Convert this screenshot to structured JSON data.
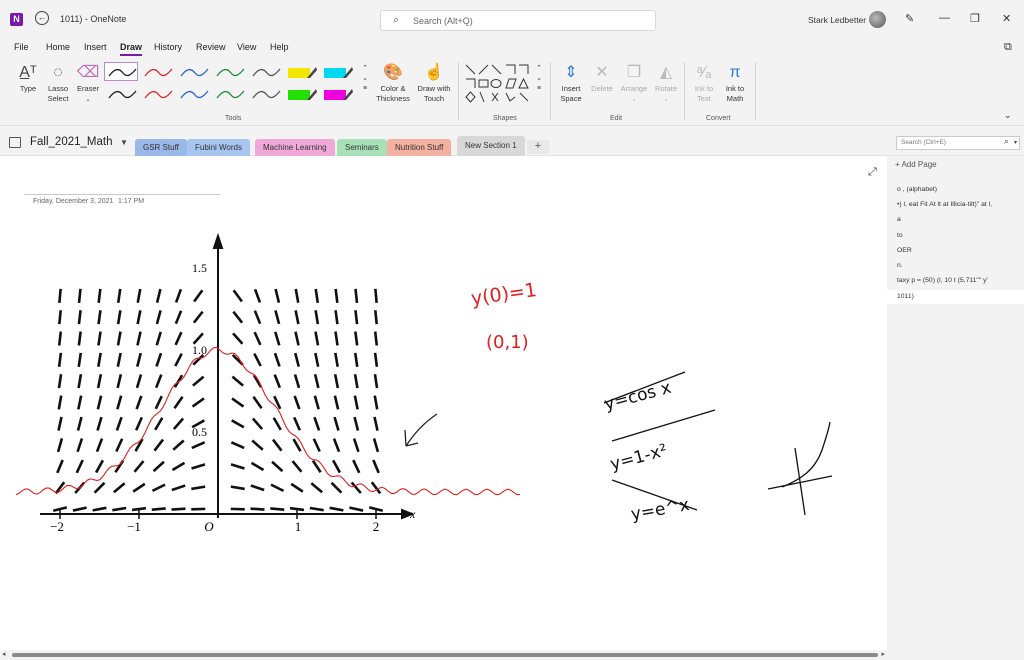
{
  "window": {
    "title": "1011) - OneNote",
    "search_placeholder": "Search (Alt+Q)",
    "user_name": "Stark Ledbetter"
  },
  "menu": {
    "items": [
      "File",
      "Home",
      "Insert",
      "Draw",
      "History",
      "Review",
      "View",
      "Help"
    ],
    "active": "Draw"
  },
  "ribbon": {
    "tools": {
      "type_label": "Type",
      "lasso_label": "Lasso\nSelect",
      "eraser_label": "Eraser",
      "group_label": "Tools"
    },
    "pens": [
      {
        "color": "#1a1a1a",
        "row": 0,
        "selected": true
      },
      {
        "color": "#d42a2a",
        "row": 0
      },
      {
        "color": "#2a5fd4",
        "row": 0
      },
      {
        "color": "#1e8a3a",
        "row": 0
      },
      {
        "color": "#555555",
        "row": 0
      },
      {
        "color": "#f5e600",
        "row": 0,
        "highlighter": true
      },
      {
        "color": "#00d8f0",
        "row": 0,
        "highlighter": true
      },
      {
        "color": "#1a1a1a",
        "row": 1
      },
      {
        "color": "#d42a2a",
        "row": 1
      },
      {
        "color": "#2a5fd4",
        "row": 1
      },
      {
        "color": "#1e8a3a",
        "row": 1
      },
      {
        "color": "#555555",
        "row": 1
      },
      {
        "color": "#22e000",
        "row": 1,
        "highlighter": true
      },
      {
        "color": "#f000e0",
        "row": 1,
        "highlighter": true
      }
    ],
    "color_thickness_label": "Color &\nThickness",
    "draw_touch_label": "Draw with\nTouch",
    "shapes_group_label": "Shapes",
    "edit": {
      "insert_space_label": "Insert\nSpace",
      "delete_label": "Delete",
      "arrange_label": "Arrange",
      "rotate_label": "Rotate",
      "group_label": "Edit"
    },
    "convert": {
      "ink_to_text_label": "Ink to\nText",
      "ink_to_math_label": "Ink to\nMath",
      "group_label": "Convert"
    }
  },
  "notebook": {
    "name": "Fall_2021_Math",
    "sections": [
      {
        "label": "GSR Stuff",
        "color": "#9ab8e8"
      },
      {
        "label": "Fubini Words",
        "color": "#a8c4f0"
      },
      {
        "label": "Machine Learning",
        "color": "#f0a8d8"
      },
      {
        "label": "Seminars",
        "color": "#a8e0b8"
      },
      {
        "label": "Nutrition Stuff",
        "color": "#f4b0a0"
      },
      {
        "label": "New Section 1",
        "color": "#d8d8d8",
        "active": true
      }
    ],
    "add_section": "+",
    "page_search_placeholder": "Search (Ctrl+E)"
  },
  "page": {
    "date": "Friday, December 3, 2021",
    "time": "1:17 PM"
  },
  "pages_pane": {
    "add_page_label": "Add Page",
    "pages": [
      "o , (alphabet)",
      "•) l, eat Fit At lt at Illicia-tilt)\" at l,",
      "a",
      "to",
      "OER",
      "n.",
      "taxy p = (50) (l, 10 t (5,711\"\" y'",
      "1011)"
    ],
    "selected_index": 7
  },
  "figure": {
    "x_ticks": [
      "−2",
      "−1",
      "O",
      "1",
      "2"
    ],
    "x_label": "x",
    "y_ticks": [
      "0.5",
      "1.0",
      "1.5"
    ],
    "slope_field": "y' = -2xy"
  },
  "handwriting": {
    "initial_condition": "y(0)=1",
    "point": "(0,1)",
    "crossed_out": [
      "y=cos x",
      "y=1-x²",
      "y=e^x"
    ]
  }
}
